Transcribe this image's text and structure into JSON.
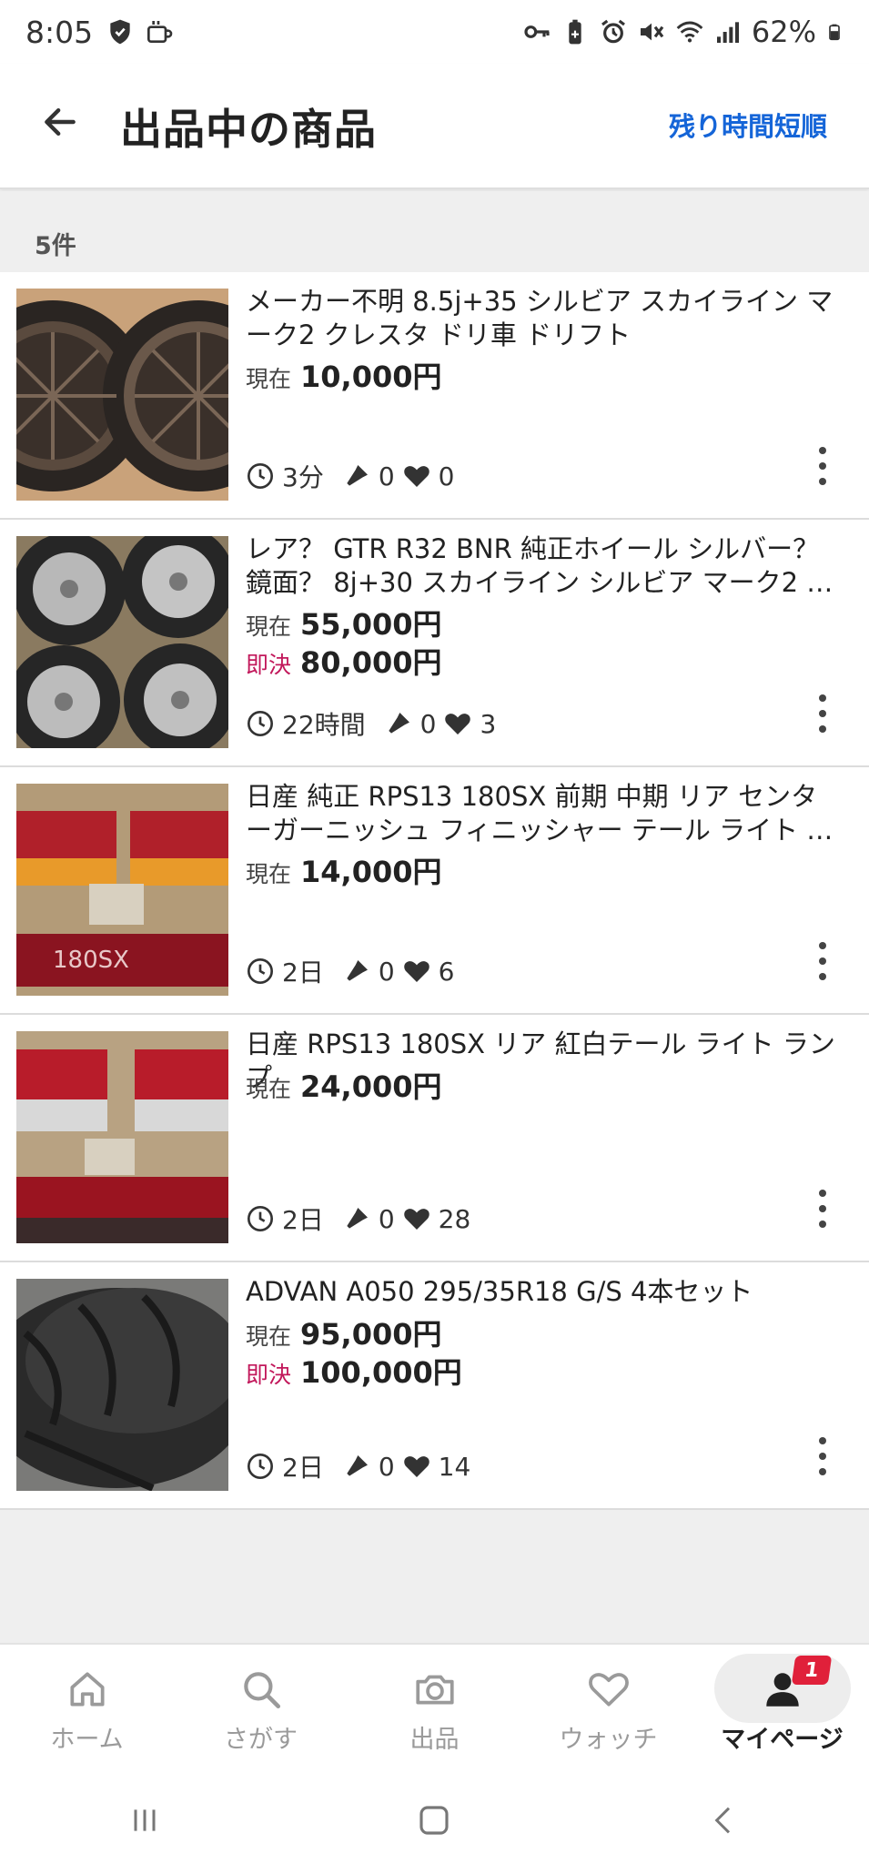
{
  "status_bar": {
    "time": "8:05",
    "battery": "62%"
  },
  "header": {
    "title": "出品中の商品",
    "sort_label": "残り時間短順"
  },
  "result_count": "5件",
  "items": [
    {
      "title": "メーカー不明 8.5j+35 シルビア スカイライン マーク2 クレスタ ドリ車 ドリフト",
      "current_label": "現在",
      "current_price": "10,000円",
      "buy_label": "",
      "buy_price": "",
      "time_left": "3分",
      "bids": "0",
      "watches": "0"
    },
    {
      "title": "レア？ GTR R32 BNR 純正ホイール シルバー？鏡面？ 8j+30 スカイライン シルビア マーク2 クレ…",
      "current_label": "現在",
      "current_price": "55,000円",
      "buy_label": "即決",
      "buy_price": "80,000円",
      "time_left": "22時間",
      "bids": "0",
      "watches": "3"
    },
    {
      "title": "日産 純正 RPS13 180SX 前期 中期 リア センターガーニッシュ フィニッシャー テール ライト ラン…",
      "current_label": "現在",
      "current_price": "14,000円",
      "buy_label": "",
      "buy_price": "",
      "time_left": "2日",
      "bids": "0",
      "watches": "6"
    },
    {
      "title": "日産 RPS13 180SX リア 紅白テール ライト ランプ",
      "current_label": "現在",
      "current_price": "24,000円",
      "buy_label": "",
      "buy_price": "",
      "time_left": "2日",
      "bids": "0",
      "watches": "28"
    },
    {
      "title": "ADVAN A050 295/35R18 G/S 4本セット",
      "current_label": "現在",
      "current_price": "95,000円",
      "buy_label": "即決",
      "buy_price": "100,000円",
      "time_left": "2日",
      "bids": "0",
      "watches": "14"
    }
  ],
  "bottom_nav": [
    {
      "label": "ホーム",
      "icon": "home-icon"
    },
    {
      "label": "さがす",
      "icon": "search-icon"
    },
    {
      "label": "出品",
      "icon": "camera-icon"
    },
    {
      "label": "ウォッチ",
      "icon": "heart-icon"
    },
    {
      "label": "マイページ",
      "icon": "person-icon",
      "badge": "1"
    }
  ],
  "colors": {
    "accent_blue": "#1565d8",
    "buy_now_red": "#c2185b",
    "badge_red": "#e0203a"
  }
}
